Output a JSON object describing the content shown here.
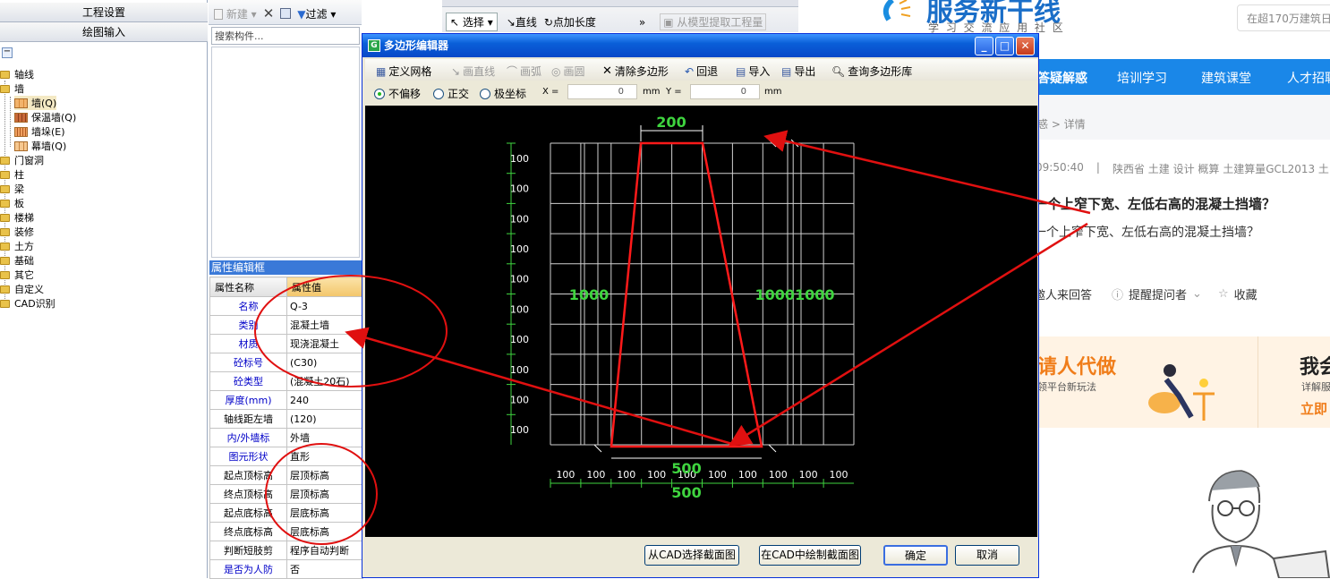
{
  "left_nav": {
    "btn_project_settings": "工程设置",
    "btn_drawing_input": "绘图输入",
    "collapse": "−",
    "tree": {
      "axis": "轴线",
      "wall": "墙",
      "wall_q": "墙(Q)",
      "insulation_wall": "保温墙(Q)",
      "wall_pier": "墙垛(E)",
      "curtain_wall": "幕墙(Q)",
      "door_window": "门窗洞",
      "column": "柱",
      "beam": "梁",
      "slab": "板",
      "stair": "楼梯",
      "decoration": "装修",
      "earthwork": "土方",
      "foundation": "基础",
      "other": "其它",
      "custom": "自定义",
      "cad_recognize": "CAD识别"
    }
  },
  "mid_pane": {
    "new_label": "新建",
    "filter_label": "过滤",
    "search_placeholder": "搜索构件...",
    "prop_title": "属性编辑框",
    "col_name": "属性名称",
    "col_value": "属性值",
    "props": [
      {
        "k": "名称",
        "v": "Q-3"
      },
      {
        "k": "类别",
        "v": "混凝土墙"
      },
      {
        "k": "材质",
        "v": "现浇混凝土"
      },
      {
        "k": "砼标号",
        "v": "(C30)"
      },
      {
        "k": "砼类型",
        "v": "(混凝土20石)"
      },
      {
        "k": "厚度(mm)",
        "v": "240"
      },
      {
        "k": "轴线距左墙",
        "v": "(120)"
      },
      {
        "k": "内/外墙标",
        "v": "外墙"
      },
      {
        "k": "图元形状",
        "v": "直形"
      },
      {
        "k": "起点顶标高",
        "v": "层顶标高"
      },
      {
        "k": "终点顶标高",
        "v": "层顶标高"
      },
      {
        "k": "起点底标高",
        "v": "层底标高"
      },
      {
        "k": "终点底标高",
        "v": "层底标高"
      },
      {
        "k": "判断短肢剪",
        "v": "程序自动判断"
      },
      {
        "k": "是否为人防",
        "v": "否"
      }
    ]
  },
  "top_toolbar": {
    "select": "选择",
    "line": "直线",
    "point_length": "点加长度",
    "more": "»",
    "extract": "从模型提取工程量"
  },
  "dialog": {
    "title": "多边形编辑器",
    "tools": {
      "define_grid": "定义网格",
      "draw_line": "画直线",
      "draw_arc": "画弧",
      "draw_circle": "画圆",
      "clear_polygon": "清除多边形",
      "undo": "回退",
      "import": "导入",
      "export": "导出",
      "query_lib": "查询多边形库"
    },
    "options": {
      "no_offset": "不偏移",
      "orthogonal": "正交",
      "polar": "极坐标",
      "x_label": "X =",
      "x_value": "0",
      "unit": "mm",
      "y_label": "Y =",
      "y_value": "0"
    },
    "canvas": {
      "top_dim": "200",
      "bottom_dim1": "500",
      "bottom_dim2": "500",
      "left_height": "1000",
      "right_height": "10001000",
      "row_label": "100",
      "grid_color": "#d0d0d0",
      "polygon_color": "#ff1a1a",
      "dim_color": "#3fd43f"
    },
    "buttons": {
      "pick_from_cad": "从CAD选择截面图",
      "draw_in_cad": "在CAD中绘制截面图",
      "ok": "确定",
      "cancel": "取消"
    }
  },
  "web": {
    "logo_text": "服务新干线",
    "logo_sub": "学 习 交 流 应 用 社 区",
    "search_hint": "在超170万建筑日",
    "nav": [
      "答疑解惑",
      "培训学习",
      "建筑课堂",
      "人才招聘"
    ],
    "breadcrumb": "惑 > 详情",
    "meta_time": "09:50:40",
    "meta_sep": "|",
    "meta_tags": "陕西省 土建 设计 概算 土建算量GCL2013 土",
    "question_title": "一个上窄下宽、左低右高的混凝土挡墙？",
    "question_body": "一个上窄下宽、左低右高的混凝土挡墙？",
    "action_invite": "邀人来回答",
    "action_remind": "提醒提问者",
    "action_fav": "收藏",
    "banner_left": "请人代做",
    "banner_left_sub": "领平台新玩法",
    "banner_right": "我会",
    "banner_right_sub": "详解服",
    "banner_right_link": "立即"
  },
  "annotation_color": "#e01010"
}
